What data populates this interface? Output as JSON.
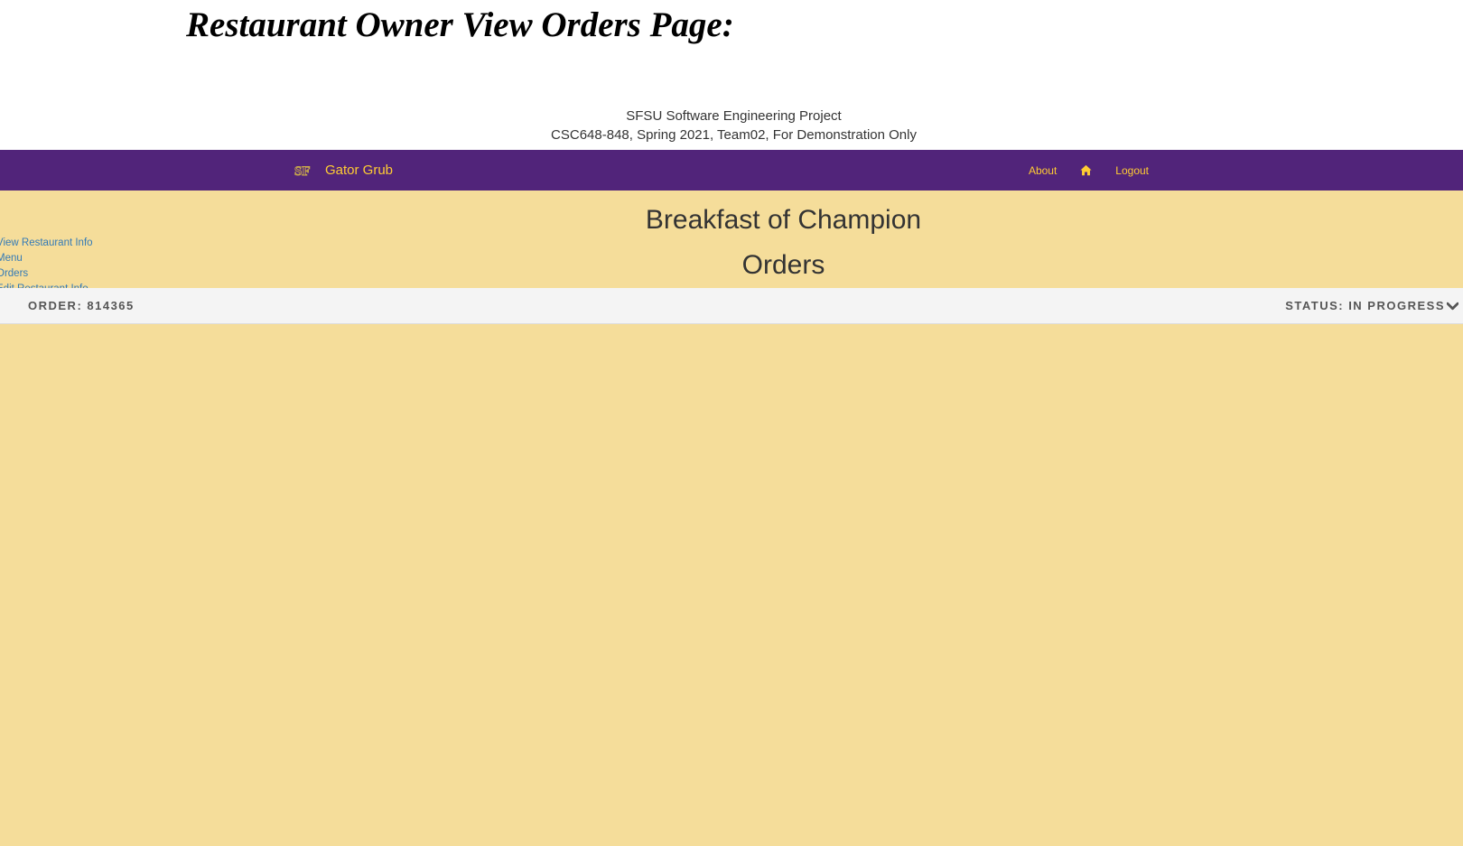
{
  "caption": "Restaurant Owner View Orders Page:",
  "banner": {
    "line1": "SFSU Software Engineering Project",
    "line2": "CSC648-848, Spring 2021, Team02, For Demonstration Only"
  },
  "navbar": {
    "brand_name": "Gator Grub",
    "brand_icon": "sf-logo-icon",
    "links": {
      "about": "About",
      "home_icon": "home-icon",
      "logout": "Logout"
    }
  },
  "sidebar": {
    "items": [
      {
        "label": "View Restaurant Info"
      },
      {
        "label": "Menu"
      },
      {
        "label": "Orders"
      },
      {
        "label": "Edit Restaurant Info"
      }
    ]
  },
  "main": {
    "restaurant_name": "Breakfast of Champion",
    "section_title": "Orders",
    "orders": [
      {
        "order_label": "ORDER: 814365",
        "status_label": "STATUS: IN PROGRESS",
        "toggle_icon": "chevron-down-icon"
      }
    ]
  },
  "colors": {
    "navbar_bg": "#51247a",
    "accent_gold": "#ffcc33",
    "content_bg": "#f5dd9a",
    "link_blue": "#337ab7",
    "order_row_bg": "#f4f4f4"
  }
}
